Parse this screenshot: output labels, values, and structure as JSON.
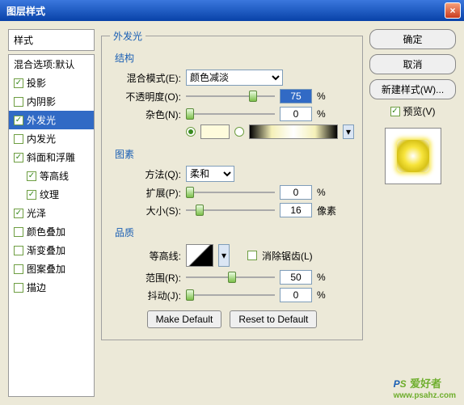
{
  "title": "图层样式",
  "left": {
    "styles_label": "样式",
    "blend_header": "混合选项:默认",
    "items": [
      {
        "label": "投影",
        "checked": true
      },
      {
        "label": "内阴影",
        "checked": false
      },
      {
        "label": "外发光",
        "checked": true,
        "selected": true
      },
      {
        "label": "内发光",
        "checked": false
      },
      {
        "label": "斜面和浮雕",
        "checked": true
      },
      {
        "label": "等高线",
        "checked": true,
        "indent": true
      },
      {
        "label": "纹理",
        "checked": true,
        "indent": true
      },
      {
        "label": "光泽",
        "checked": true
      },
      {
        "label": "颜色叠加",
        "checked": false
      },
      {
        "label": "渐变叠加",
        "checked": false
      },
      {
        "label": "图案叠加",
        "checked": false
      },
      {
        "label": "描边",
        "checked": false
      }
    ]
  },
  "mid": {
    "panel_title": "外发光",
    "struct_title": "结构",
    "blend_mode_label": "混合模式(E):",
    "blend_mode_value": "颜色减淡",
    "opacity_label": "不透明度(O):",
    "opacity_value": "75",
    "pct": "%",
    "noise_label": "杂色(N):",
    "noise_value": "0",
    "elements_title": "图素",
    "method_label": "方法(Q):",
    "method_value": "柔和",
    "spread_label": "扩展(P):",
    "spread_value": "0",
    "size_label": "大小(S):",
    "size_value": "16",
    "px": "像素",
    "quality_title": "品质",
    "contour_label": "等高线:",
    "antialias_label": "消除锯齿(L)",
    "range_label": "范围(R):",
    "range_value": "50",
    "jitter_label": "抖动(J):",
    "jitter_value": "0",
    "make_default": "Make Default",
    "reset_default": "Reset to Default"
  },
  "right": {
    "ok": "确定",
    "cancel": "取消",
    "new_style": "新建样式(W)...",
    "preview": "预览(V)"
  },
  "watermark": {
    "brand_p": "P",
    "brand_s": "S",
    "brand_cn": "爱好者",
    "url": "www.psahz.com"
  }
}
